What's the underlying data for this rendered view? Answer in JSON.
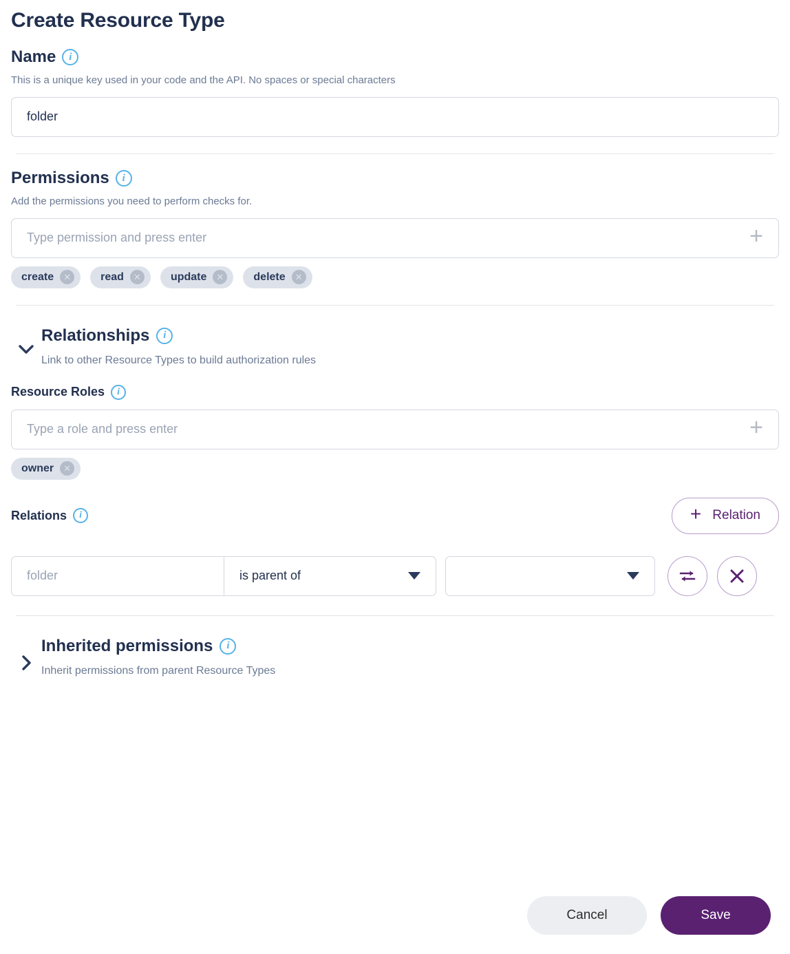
{
  "page": {
    "title": "Create Resource Type"
  },
  "name_section": {
    "label": "Name",
    "info_icon": "info-icon",
    "helper": "This is a unique key used in your code and the API. No spaces or special characters",
    "input_value": "folder"
  },
  "permissions_section": {
    "label": "Permissions",
    "info_icon": "info-icon",
    "helper": "Add the permissions you need to perform checks for.",
    "input_placeholder": "Type permission and press enter",
    "add_icon": "plus-icon",
    "chips": [
      {
        "label": "create",
        "remove_icon": "close-circle-icon"
      },
      {
        "label": "read",
        "remove_icon": "close-circle-icon"
      },
      {
        "label": "update",
        "remove_icon": "close-circle-icon"
      },
      {
        "label": "delete",
        "remove_icon": "close-circle-icon"
      }
    ]
  },
  "relationships_section": {
    "chevron_icon": "chevron-down-icon",
    "expanded": true,
    "title": "Relationships",
    "info_icon": "info-icon",
    "subtitle": "Link to other Resource Types to build authorization rules",
    "resource_roles": {
      "label": "Resource Roles",
      "info_icon": "info-icon",
      "input_placeholder": "Type a role and press enter",
      "add_icon": "plus-icon",
      "chips": [
        {
          "label": "owner",
          "remove_icon": "close-circle-icon"
        }
      ]
    },
    "relations": {
      "label": "Relations",
      "info_icon": "info-icon",
      "add_button": {
        "plus": "+",
        "label": "Relation",
        "icon": "plus-icon"
      },
      "rows": [
        {
          "subject_placeholder": "folder",
          "subject_value": "",
          "predicate_value": "is parent of",
          "predicate_caret_icon": "chevron-down-icon",
          "object_value": "",
          "object_caret_icon": "chevron-down-icon",
          "swap_icon": "swap-arrows-icon",
          "delete_icon": "close-icon"
        }
      ]
    }
  },
  "inherited_section": {
    "chevron_icon": "chevron-right-icon",
    "expanded": false,
    "title": "Inherited permissions",
    "info_icon": "info-icon",
    "subtitle": "Inherit permissions from parent Resource Types"
  },
  "footer": {
    "cancel_label": "Cancel",
    "save_label": "Save"
  },
  "colors": {
    "brand_purple": "#5a2171",
    "brand_purple_border": "#b79cc8",
    "navy": "#22304f",
    "info_blue": "#56b2e8",
    "chip_bg": "#dde2ea",
    "border": "#d3d7df",
    "divider": "#e2e4e9",
    "cancel_bg": "#eceef2"
  }
}
